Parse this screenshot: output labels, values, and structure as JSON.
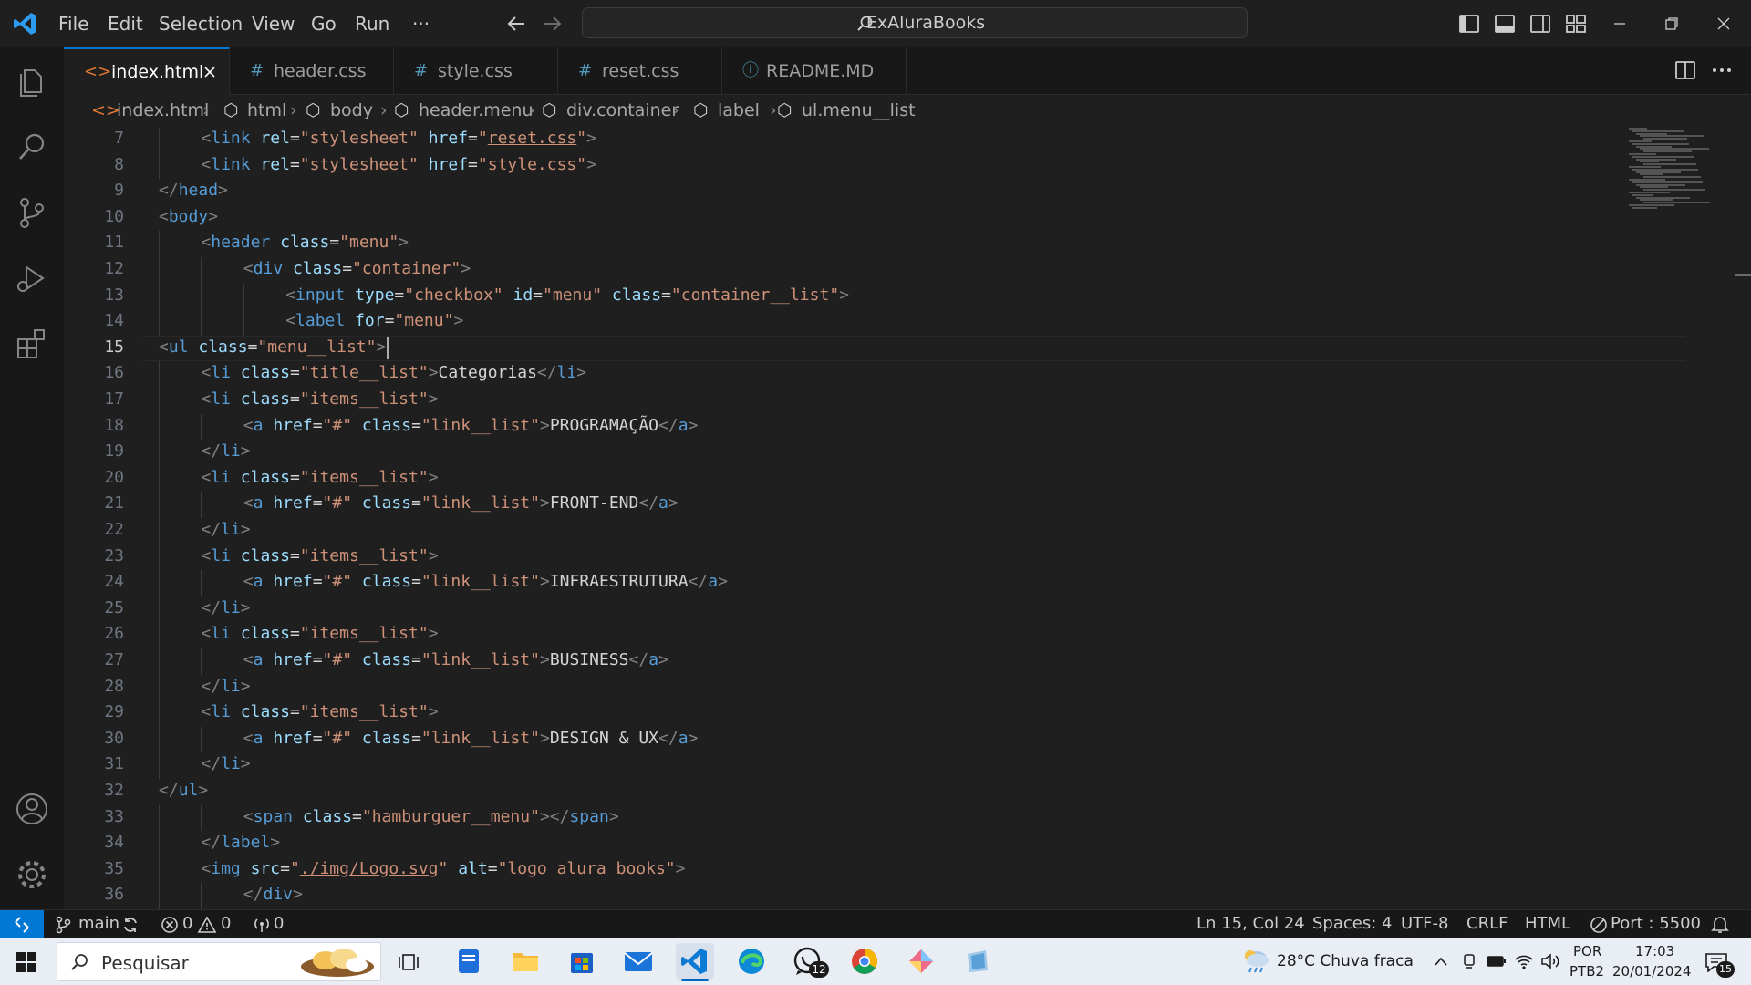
{
  "menu": {
    "items": [
      "File",
      "Edit",
      "Selection",
      "View",
      "Go",
      "Run",
      "···"
    ],
    "search_text": "ExAluraBooks"
  },
  "tabs": [
    {
      "label": "index.html",
      "icon": "<>",
      "active": true
    },
    {
      "label": "header.css",
      "icon": "#",
      "active": false
    },
    {
      "label": "style.css",
      "icon": "#",
      "active": false
    },
    {
      "label": "reset.css",
      "icon": "#",
      "active": false
    },
    {
      "label": "README.MD",
      "icon": "ⓘ",
      "active": false
    }
  ],
  "breadcrumb": [
    "index.html",
    "html",
    "body",
    "header.menu",
    "div.container",
    "label",
    "ul.menu__list"
  ],
  "editor": {
    "current_line": 15,
    "lines": [
      {
        "n": "7",
        "indent": 1,
        "tokens": [
          [
            "br",
            "<"
          ],
          [
            "tag",
            "link"
          ],
          [
            "t",
            " "
          ],
          [
            "attr",
            "rel"
          ],
          [
            "t",
            "="
          ],
          [
            "str",
            "\"stylesheet\""
          ],
          [
            "t",
            " "
          ],
          [
            "attr",
            "href"
          ],
          [
            "t",
            "="
          ],
          [
            "str",
            "\""
          ],
          [
            "strl",
            "reset.css"
          ],
          [
            "str",
            "\""
          ],
          [
            "br",
            ">"
          ]
        ]
      },
      {
        "n": "8",
        "indent": 1,
        "tokens": [
          [
            "br",
            "<"
          ],
          [
            "tag",
            "link"
          ],
          [
            "t",
            " "
          ],
          [
            "attr",
            "rel"
          ],
          [
            "t",
            "="
          ],
          [
            "str",
            "\"stylesheet\""
          ],
          [
            "t",
            " "
          ],
          [
            "attr",
            "href"
          ],
          [
            "t",
            "="
          ],
          [
            "str",
            "\""
          ],
          [
            "strl",
            "style.css"
          ],
          [
            "str",
            "\""
          ],
          [
            "br",
            ">"
          ]
        ]
      },
      {
        "n": "9",
        "indent": 0,
        "tokens": [
          [
            "br",
            "</"
          ],
          [
            "tag",
            "head"
          ],
          [
            "br",
            ">"
          ]
        ]
      },
      {
        "n": "10",
        "indent": 0,
        "tokens": [
          [
            "br",
            "<"
          ],
          [
            "tag",
            "body"
          ],
          [
            "br",
            ">"
          ]
        ]
      },
      {
        "n": "11",
        "indent": 1,
        "tokens": [
          [
            "br",
            "<"
          ],
          [
            "tag",
            "header"
          ],
          [
            "t",
            " "
          ],
          [
            "attr",
            "class"
          ],
          [
            "t",
            "="
          ],
          [
            "str",
            "\"menu\""
          ],
          [
            "br",
            ">"
          ]
        ]
      },
      {
        "n": "12",
        "indent": 2,
        "tokens": [
          [
            "br",
            "<"
          ],
          [
            "tag",
            "div"
          ],
          [
            "t",
            " "
          ],
          [
            "attr",
            "class"
          ],
          [
            "t",
            "="
          ],
          [
            "str",
            "\"container\""
          ],
          [
            "br",
            ">"
          ]
        ]
      },
      {
        "n": "13",
        "indent": 3,
        "tokens": [
          [
            "br",
            "<"
          ],
          [
            "tag",
            "input"
          ],
          [
            "t",
            " "
          ],
          [
            "attr",
            "type"
          ],
          [
            "t",
            "="
          ],
          [
            "str",
            "\"checkbox\""
          ],
          [
            "t",
            " "
          ],
          [
            "attr",
            "id"
          ],
          [
            "t",
            "="
          ],
          [
            "str",
            "\"menu\""
          ],
          [
            "t",
            " "
          ],
          [
            "attr",
            "class"
          ],
          [
            "t",
            "="
          ],
          [
            "str",
            "\"container__list\""
          ],
          [
            "br",
            ">"
          ]
        ]
      },
      {
        "n": "14",
        "indent": 3,
        "tokens": [
          [
            "br",
            "<"
          ],
          [
            "tag",
            "label"
          ],
          [
            "t",
            " "
          ],
          [
            "attr",
            "for"
          ],
          [
            "t",
            "="
          ],
          [
            "str",
            "\"menu\""
          ],
          [
            "br",
            ">"
          ]
        ]
      },
      {
        "n": "15",
        "indent": 0,
        "tokens": [
          [
            "br",
            "<"
          ],
          [
            "tag",
            "ul"
          ],
          [
            "t",
            " "
          ],
          [
            "attr",
            "class"
          ],
          [
            "t",
            "="
          ],
          [
            "str",
            "\"menu__list\""
          ],
          [
            "br",
            ">"
          ]
        ]
      },
      {
        "n": "16",
        "indent": 1,
        "tokens": [
          [
            "br",
            "<"
          ],
          [
            "tag",
            "li"
          ],
          [
            "t",
            " "
          ],
          [
            "attr",
            "class"
          ],
          [
            "t",
            "="
          ],
          [
            "str",
            "\"title__list\""
          ],
          [
            "br",
            ">"
          ],
          [
            "t",
            "Categorias"
          ],
          [
            "br",
            "</"
          ],
          [
            "tag",
            "li"
          ],
          [
            "br",
            ">"
          ]
        ]
      },
      {
        "n": "17",
        "indent": 1,
        "tokens": [
          [
            "br",
            "<"
          ],
          [
            "tag",
            "li"
          ],
          [
            "t",
            " "
          ],
          [
            "attr",
            "class"
          ],
          [
            "t",
            "="
          ],
          [
            "str",
            "\"items__list\""
          ],
          [
            "br",
            ">"
          ]
        ]
      },
      {
        "n": "18",
        "indent": 2,
        "tokens": [
          [
            "br",
            "<"
          ],
          [
            "tag",
            "a"
          ],
          [
            "t",
            " "
          ],
          [
            "attr",
            "href"
          ],
          [
            "t",
            "="
          ],
          [
            "str",
            "\"#\""
          ],
          [
            "t",
            " "
          ],
          [
            "attr",
            "class"
          ],
          [
            "t",
            "="
          ],
          [
            "str",
            "\"link__list\""
          ],
          [
            "br",
            ">"
          ],
          [
            "t",
            "PROGRAMAÇÃO"
          ],
          [
            "br",
            "</"
          ],
          [
            "tag",
            "a"
          ],
          [
            "br",
            ">"
          ]
        ]
      },
      {
        "n": "19",
        "indent": 1,
        "tokens": [
          [
            "br",
            "</"
          ],
          [
            "tag",
            "li"
          ],
          [
            "br",
            ">"
          ]
        ]
      },
      {
        "n": "20",
        "indent": 1,
        "tokens": [
          [
            "br",
            "<"
          ],
          [
            "tag",
            "li"
          ],
          [
            "t",
            " "
          ],
          [
            "attr",
            "class"
          ],
          [
            "t",
            "="
          ],
          [
            "str",
            "\"items__list\""
          ],
          [
            "br",
            ">"
          ]
        ]
      },
      {
        "n": "21",
        "indent": 2,
        "tokens": [
          [
            "br",
            "<"
          ],
          [
            "tag",
            "a"
          ],
          [
            "t",
            " "
          ],
          [
            "attr",
            "href"
          ],
          [
            "t",
            "="
          ],
          [
            "str",
            "\"#\""
          ],
          [
            "t",
            " "
          ],
          [
            "attr",
            "class"
          ],
          [
            "t",
            "="
          ],
          [
            "str",
            "\"link__list\""
          ],
          [
            "br",
            ">"
          ],
          [
            "t",
            "FRONT-END"
          ],
          [
            "br",
            "</"
          ],
          [
            "tag",
            "a"
          ],
          [
            "br",
            ">"
          ]
        ]
      },
      {
        "n": "22",
        "indent": 1,
        "tokens": [
          [
            "br",
            "</"
          ],
          [
            "tag",
            "li"
          ],
          [
            "br",
            ">"
          ]
        ]
      },
      {
        "n": "23",
        "indent": 1,
        "tokens": [
          [
            "br",
            "<"
          ],
          [
            "tag",
            "li"
          ],
          [
            "t",
            " "
          ],
          [
            "attr",
            "class"
          ],
          [
            "t",
            "="
          ],
          [
            "str",
            "\"items__list\""
          ],
          [
            "br",
            ">"
          ]
        ]
      },
      {
        "n": "24",
        "indent": 2,
        "tokens": [
          [
            "br",
            "<"
          ],
          [
            "tag",
            "a"
          ],
          [
            "t",
            " "
          ],
          [
            "attr",
            "href"
          ],
          [
            "t",
            "="
          ],
          [
            "str",
            "\"#\""
          ],
          [
            "t",
            " "
          ],
          [
            "attr",
            "class"
          ],
          [
            "t",
            "="
          ],
          [
            "str",
            "\"link__list\""
          ],
          [
            "br",
            ">"
          ],
          [
            "t",
            "INFRAESTRUTURA"
          ],
          [
            "br",
            "</"
          ],
          [
            "tag",
            "a"
          ],
          [
            "br",
            ">"
          ]
        ]
      },
      {
        "n": "25",
        "indent": 1,
        "tokens": [
          [
            "br",
            "</"
          ],
          [
            "tag",
            "li"
          ],
          [
            "br",
            ">"
          ]
        ]
      },
      {
        "n": "26",
        "indent": 1,
        "tokens": [
          [
            "br",
            "<"
          ],
          [
            "tag",
            "li"
          ],
          [
            "t",
            " "
          ],
          [
            "attr",
            "class"
          ],
          [
            "t",
            "="
          ],
          [
            "str",
            "\"items__list\""
          ],
          [
            "br",
            ">"
          ]
        ]
      },
      {
        "n": "27",
        "indent": 2,
        "tokens": [
          [
            "br",
            "<"
          ],
          [
            "tag",
            "a"
          ],
          [
            "t",
            " "
          ],
          [
            "attr",
            "href"
          ],
          [
            "t",
            "="
          ],
          [
            "str",
            "\"#\""
          ],
          [
            "t",
            " "
          ],
          [
            "attr",
            "class"
          ],
          [
            "t",
            "="
          ],
          [
            "str",
            "\"link__list\""
          ],
          [
            "br",
            ">"
          ],
          [
            "t",
            "BUSINESS"
          ],
          [
            "br",
            "</"
          ],
          [
            "tag",
            "a"
          ],
          [
            "br",
            ">"
          ]
        ]
      },
      {
        "n": "28",
        "indent": 1,
        "tokens": [
          [
            "br",
            "</"
          ],
          [
            "tag",
            "li"
          ],
          [
            "br",
            ">"
          ]
        ]
      },
      {
        "n": "29",
        "indent": 1,
        "tokens": [
          [
            "br",
            "<"
          ],
          [
            "tag",
            "li"
          ],
          [
            "t",
            " "
          ],
          [
            "attr",
            "class"
          ],
          [
            "t",
            "="
          ],
          [
            "str",
            "\"items__list\""
          ],
          [
            "br",
            ">"
          ]
        ]
      },
      {
        "n": "30",
        "indent": 2,
        "tokens": [
          [
            "br",
            "<"
          ],
          [
            "tag",
            "a"
          ],
          [
            "t",
            " "
          ],
          [
            "attr",
            "href"
          ],
          [
            "t",
            "="
          ],
          [
            "str",
            "\"#\""
          ],
          [
            "t",
            " "
          ],
          [
            "attr",
            "class"
          ],
          [
            "t",
            "="
          ],
          [
            "str",
            "\"link__list\""
          ],
          [
            "br",
            ">"
          ],
          [
            "t",
            "DESIGN & UX"
          ],
          [
            "br",
            "</"
          ],
          [
            "tag",
            "a"
          ],
          [
            "br",
            ">"
          ]
        ]
      },
      {
        "n": "31",
        "indent": 1,
        "tokens": [
          [
            "br",
            "</"
          ],
          [
            "tag",
            "li"
          ],
          [
            "br",
            ">"
          ]
        ]
      },
      {
        "n": "32",
        "indent": 0,
        "tokens": [
          [
            "br",
            "</"
          ],
          [
            "tag",
            "ul"
          ],
          [
            "br",
            ">"
          ]
        ]
      },
      {
        "n": "33",
        "indent": 2,
        "tokens": [
          [
            "br",
            "<"
          ],
          [
            "tag",
            "span"
          ],
          [
            "t",
            " "
          ],
          [
            "attr",
            "class"
          ],
          [
            "t",
            "="
          ],
          [
            "str",
            "\"hamburguer__menu\""
          ],
          [
            "br",
            "></"
          ],
          [
            "tag",
            "span"
          ],
          [
            "br",
            ">"
          ]
        ]
      },
      {
        "n": "34",
        "indent": 1,
        "tokens": [
          [
            "br",
            "</"
          ],
          [
            "tag",
            "label"
          ],
          [
            "br",
            ">"
          ]
        ]
      },
      {
        "n": "35",
        "indent": 1,
        "tokens": [
          [
            "br",
            "<"
          ],
          [
            "tag",
            "img"
          ],
          [
            "t",
            " "
          ],
          [
            "attr",
            "src"
          ],
          [
            "t",
            "="
          ],
          [
            "str",
            "\""
          ],
          [
            "strl",
            "./img/Logo.svg"
          ],
          [
            "str",
            "\""
          ],
          [
            "t",
            " "
          ],
          [
            "attr",
            "alt"
          ],
          [
            "t",
            "="
          ],
          [
            "str",
            "\"logo alura books\""
          ],
          [
            "br",
            ">"
          ]
        ]
      },
      {
        "n": "36",
        "indent": 2,
        "tokens": [
          [
            "br",
            "</"
          ],
          [
            "tag",
            "div"
          ],
          [
            "br",
            ">"
          ]
        ]
      }
    ]
  },
  "status": {
    "branch": "main",
    "errors": "0",
    "warnings": "0",
    "ports": "0",
    "position": "Ln 15, Col 24",
    "spaces": "Spaces: 4",
    "encoding": "UTF-8",
    "eol": "CRLF",
    "language": "HTML",
    "port": "Port : 5500"
  },
  "taskbar": {
    "search_placeholder": "Pesquisar",
    "whatsapp_badge": "12",
    "weather": "28°C  Chuva fraca",
    "lang1": "POR",
    "lang2": "PTB2",
    "time": "17:03",
    "date": "20/01/2024",
    "notif_badge": "15"
  },
  "colors": {
    "accent": "#0078d4",
    "tag": "#569cd6",
    "attr": "#9cdcfe",
    "string": "#ce9178"
  }
}
